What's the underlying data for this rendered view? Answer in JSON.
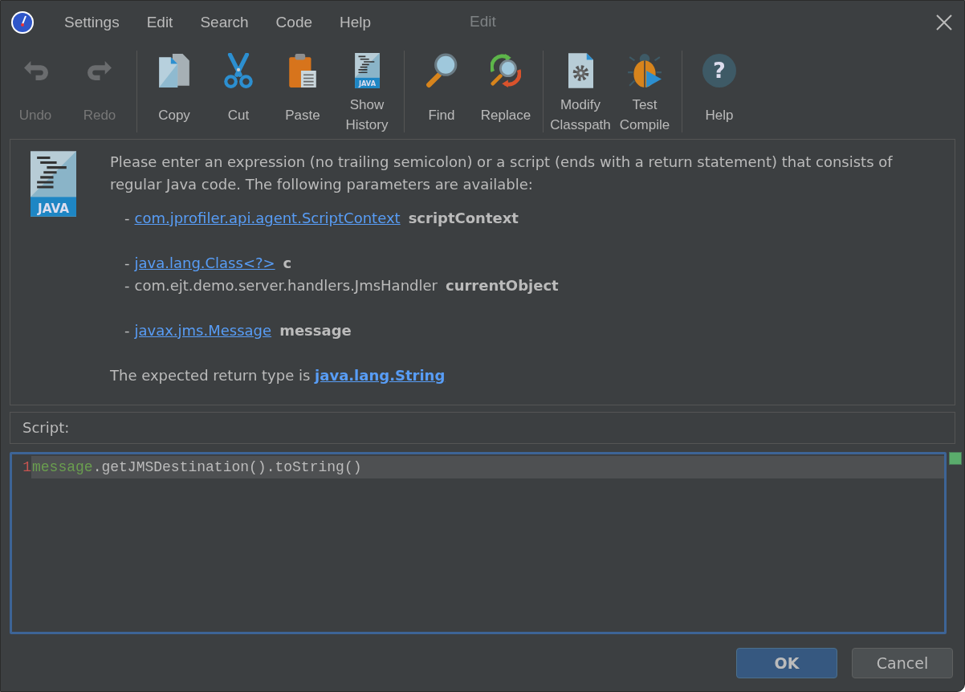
{
  "window": {
    "title": "Edit"
  },
  "menu": [
    "Settings",
    "Edit",
    "Search",
    "Code",
    "Help"
  ],
  "toolbar": [
    [
      {
        "label": "Undo",
        "disabled": true
      },
      {
        "label": "Redo",
        "disabled": true
      }
    ],
    [
      {
        "label": "Copy",
        "disabled": false
      },
      {
        "label": "Cut",
        "disabled": false
      },
      {
        "label": "Paste",
        "disabled": false
      },
      {
        "label": "Show History",
        "icon_label": "JAVA",
        "disabled": false
      }
    ],
    [
      {
        "label": "Find",
        "disabled": false
      },
      {
        "label": "Replace",
        "disabled": false
      }
    ],
    [
      {
        "label": "Modify Classpath",
        "disabled": false
      },
      {
        "label": "Test Compile",
        "disabled": false
      }
    ],
    [
      {
        "label": "Help",
        "icon_label": "?",
        "disabled": false
      }
    ]
  ],
  "info": {
    "icon_label": "JAVA",
    "intro": "Please enter an expression (no trailing semicolon) or a script (ends with a return statement) that consists of regular Java code. The following parameters are available:",
    "parameter_groups": [
      [
        {
          "bullet": "-",
          "type": "com.jprofiler.api.agent.ScriptContext",
          "link": true,
          "name": "scriptContext"
        }
      ],
      [
        {
          "bullet": "-",
          "type": "java.lang.Class<?> ",
          "link": true,
          "name": "c"
        },
        {
          "bullet": "-",
          "type": "com.ejt.demo.server.handlers.JmsHandler",
          "link": false,
          "name": "currentObject"
        }
      ],
      [
        {
          "bullet": "-",
          "type": "javax.jms.Message",
          "link": true,
          "name": "message"
        }
      ]
    ],
    "return_text": "The expected return type is",
    "return_type": "java.lang.String"
  },
  "script_label": "Script:",
  "editor": {
    "lines": [
      {
        "number": "1",
        "current": true,
        "tokens": [
          {
            "text": "message",
            "kind": "variable"
          },
          {
            "text": ".getJMSDestination().toString()",
            "kind": "plain"
          }
        ]
      }
    ]
  },
  "buttons": [
    {
      "label": "OK",
      "kind": "default"
    },
    {
      "label": "Cancel",
      "kind": "normal"
    }
  ]
}
